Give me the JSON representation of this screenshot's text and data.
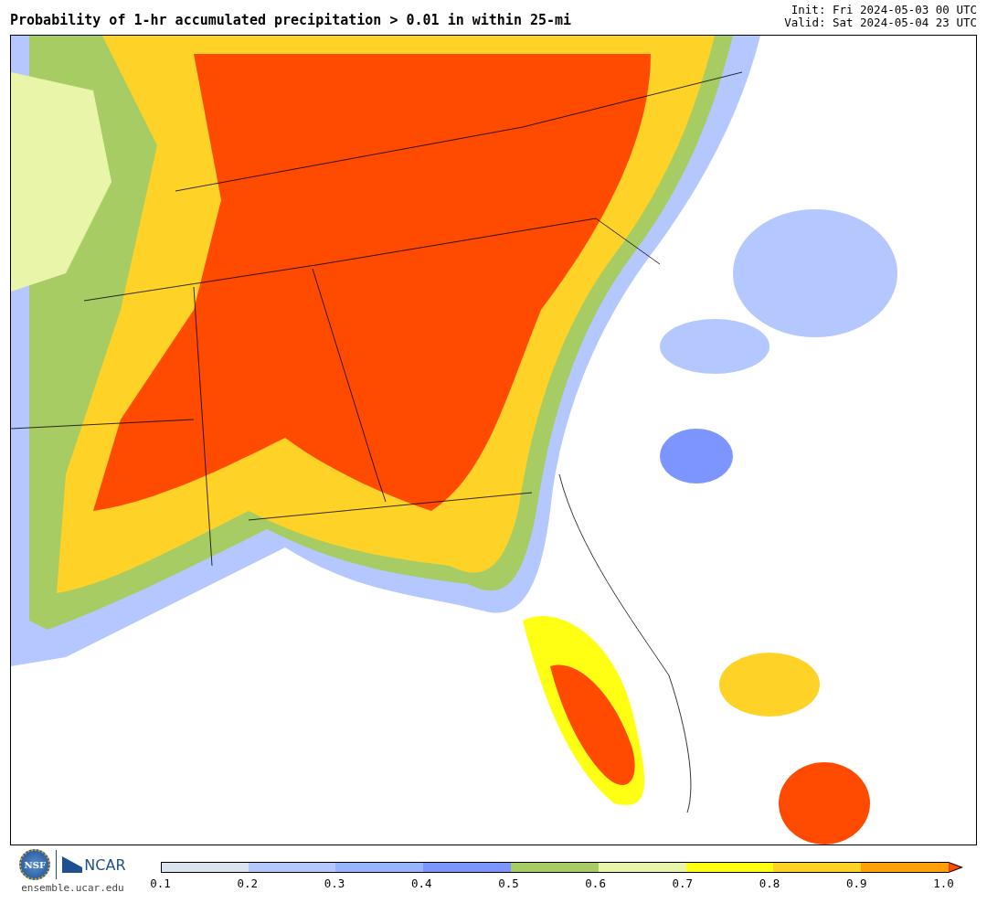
{
  "header": {
    "title": "Probability of 1-hr accumulated precipitation > 0.01 in within 25-mi",
    "init": "Init: Fri 2024-05-03 00 UTC",
    "valid": "Valid: Sat 2024-05-04 23 UTC"
  },
  "logos": {
    "nsf": "NSF",
    "ncar": "NCAR",
    "url": "ensemble.ucar.edu"
  },
  "colorbar": {
    "bins": [
      {
        "color": "#d9e4ee"
      },
      {
        "color": "#b4c8ff"
      },
      {
        "color": "#96b4ff"
      },
      {
        "color": "#7d96ff"
      },
      {
        "color": "#a8cc64"
      },
      {
        "color": "#e9f5a8"
      },
      {
        "color": "#ffff14"
      },
      {
        "color": "#ffd228"
      },
      {
        "color": "#ffa00a"
      }
    ],
    "extension": {
      "color": "#ff4b00"
    },
    "ticks": [
      "0.1",
      "0.2",
      "0.3",
      "0.4",
      "0.5",
      "0.6",
      "0.7",
      "0.8",
      "0.9",
      "1.0"
    ]
  }
}
